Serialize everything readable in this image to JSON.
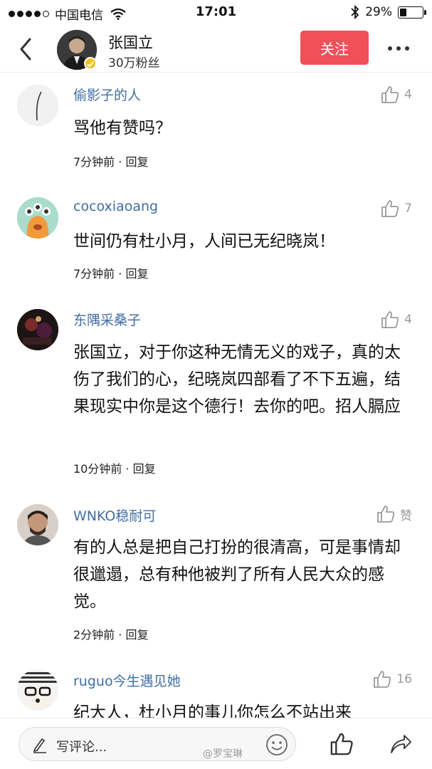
{
  "status_bar": {
    "carrier": "中国电信",
    "time": "17:01",
    "battery": "29%",
    "battery_level": 0.29
  },
  "header": {
    "author_name": "张国立",
    "fans": "30万粉丝",
    "follow_label": "关注"
  },
  "comments": [
    {
      "name": "偷影子的人",
      "likes": "4",
      "text": "骂他有赞吗？",
      "time": "7分钟前",
      "reply": "回复"
    },
    {
      "name": "cocoxiaoang",
      "likes": "7",
      "text": "世间仍有杜小月，人间已无纪晓岚！",
      "time": "7分钟前",
      "reply": "回复"
    },
    {
      "name": "东隅采桑子",
      "likes": "4",
      "text": "张国立，对于你这种无情无义的戏子，真的太伤了我们的心，纪晓岚四部看了不下五遍，结果现实中你是这个德行！去你的吧。招人膈应",
      "time": "10分钟前",
      "reply": "回复"
    },
    {
      "name": "WNKO稳耐可",
      "likes": "赞",
      "text": "有的人总是把自己打扮的很清高，可是事情却很邋遢，总有种他被判了所有人民大众的感觉。",
      "time": "2分钟前",
      "reply": "回复"
    },
    {
      "name": "ruguo今生遇见她",
      "likes": "16",
      "text": "纪大人，杜小月的事儿你怎么不站出来",
      "time": "",
      "reply": ""
    }
  ],
  "bottom_bar": {
    "input_placeholder": "写评论...",
    "watermark": "@罗宝琳"
  },
  "colors": {
    "follow_button": "#f0505a",
    "username": "#3f6ea3",
    "meta_text": "#222222",
    "like_gray": "#9a9a9a"
  },
  "icons": {
    "back": "chevron-left-icon",
    "more": "more-dots-icon",
    "like": "thumbs-up-icon",
    "pen": "pen-icon",
    "emoji": "smiley-icon",
    "share": "share-arrow-icon"
  }
}
